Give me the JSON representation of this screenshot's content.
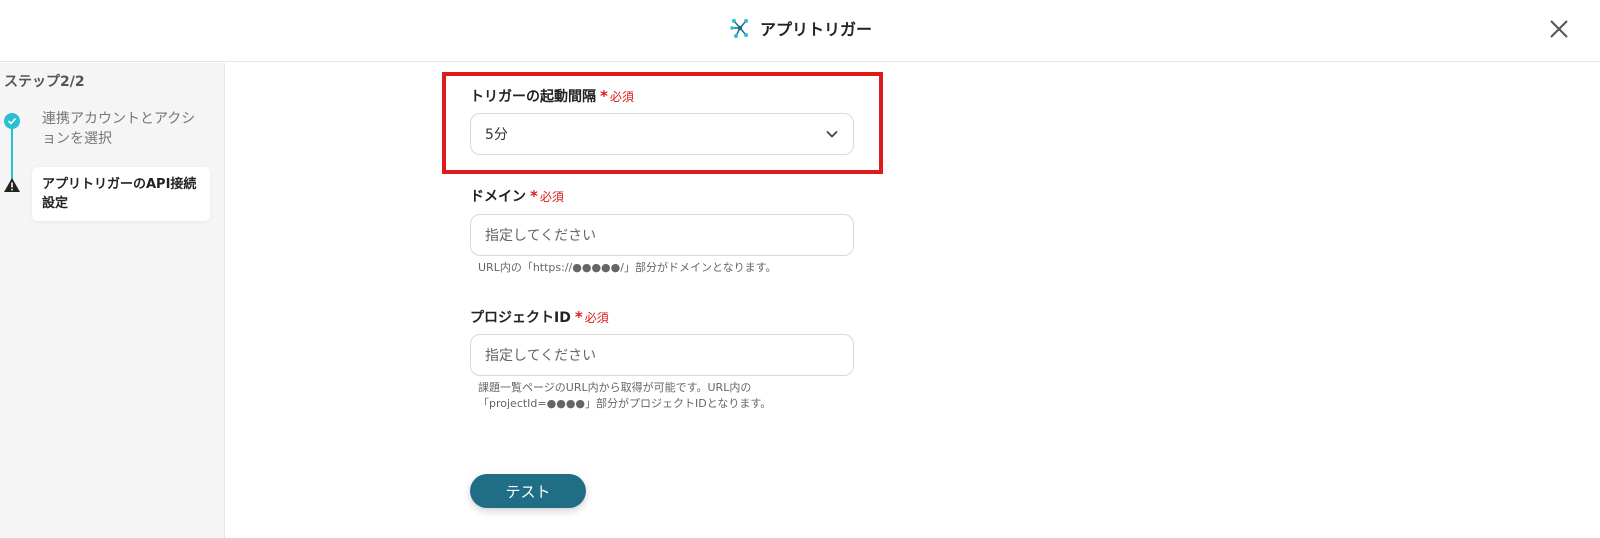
{
  "header": {
    "title": "アプリトリガー",
    "icon": "app-trigger-icon",
    "close_icon": "close-icon"
  },
  "sidebar": {
    "step_count": "ステップ2/2",
    "steps": [
      {
        "label": "連携アカウントとアクションを選択",
        "status": "done"
      },
      {
        "label": "アプリトリガーのAPI接続設定",
        "status": "warning"
      }
    ]
  },
  "form": {
    "required_label": "必須",
    "trigger_interval": {
      "label": "トリガーの起動間隔",
      "value": "5分"
    },
    "domain": {
      "label": "ドメイン",
      "placeholder": "指定してください",
      "hint": "URL内の「https://●●●●●/」部分がドメインとなります。"
    },
    "project_id": {
      "label": "プロジェクトID",
      "placeholder": "指定してください",
      "hint": "課題一覧ページのURL内から取得が可能です。URL内の「projectId=●●●●」部分がプロジェクトIDとなります。"
    },
    "test_button": "テスト"
  },
  "colors": {
    "accent": "#2bbfd4",
    "button": "#1f6e86",
    "required": "#e01b1b",
    "highlight": "#e01b1b"
  }
}
